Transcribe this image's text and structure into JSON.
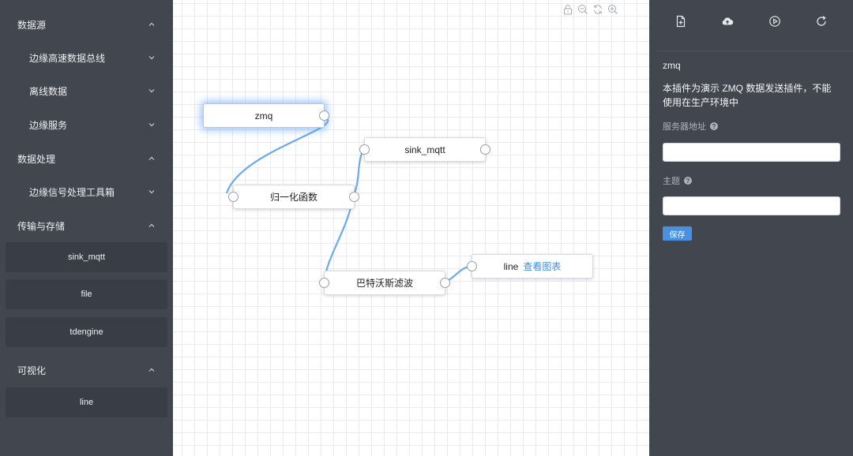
{
  "sidebar": {
    "sections": [
      {
        "label": "数据源"
      },
      {
        "label": "数据处理"
      },
      {
        "label": "传输与存储"
      },
      {
        "label": "可视化"
      }
    ],
    "subsections": [
      {
        "label": "边缘高速数据总线"
      },
      {
        "label": "离线数据"
      },
      {
        "label": "边缘服务"
      },
      {
        "label": "边缘信号处理工具箱"
      }
    ],
    "plugins": [
      {
        "label": "sink_mqtt"
      },
      {
        "label": "file"
      },
      {
        "label": "tdengine"
      },
      {
        "label": "line"
      }
    ]
  },
  "canvas": {
    "toolbar_icons": [
      "unlock-icon",
      "zoom-out-icon",
      "refresh-icon",
      "zoom-in-icon"
    ],
    "nodes": [
      {
        "label": "zmq",
        "selected": true
      },
      {
        "label": "sink_mqtt"
      },
      {
        "label": "归一化函数"
      },
      {
        "label": "巴特沃斯滤波"
      },
      {
        "label": "line",
        "link": "查看图表"
      }
    ],
    "edges": [
      {
        "from": "zmq",
        "to": "归一化函数"
      },
      {
        "from": "归一化函数",
        "to": "sink_mqtt"
      },
      {
        "from": "归一化函数",
        "to": "巴特沃斯滤波"
      },
      {
        "from": "巴特沃斯滤波",
        "to": "line"
      }
    ],
    "edge_color": "#6aaaf0"
  },
  "panel": {
    "toolbar_icons": [
      "new-file-icon",
      "upload-cloud-icon",
      "run-icon",
      "reload-icon"
    ],
    "title": "zmq",
    "description": "本插件为演示 ZMQ 数据发送插件，不能使用在生产环境中",
    "fields": [
      {
        "label": "服务器地址",
        "value": "",
        "placeholder": ""
      },
      {
        "label": "主题",
        "value": "",
        "placeholder": ""
      }
    ],
    "save_label": "保存",
    "accent_color": "#4a90e2"
  }
}
